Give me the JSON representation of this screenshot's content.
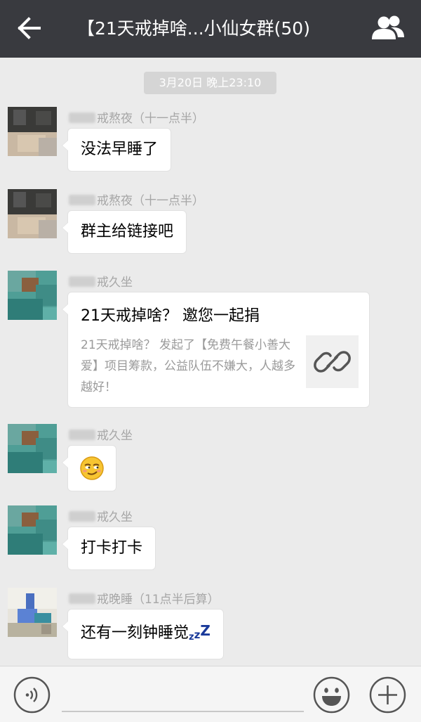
{
  "header": {
    "title": "【21天戒掉啥...小仙女群(50)",
    "back_icon": "arrow-left-icon",
    "group_icon": "group-members-icon"
  },
  "chat": {
    "timestamp": "3月20日 晚上23:10",
    "messages": [
      {
        "sender": "戒熬夜（十一点半）",
        "text": "没法早睡了"
      },
      {
        "sender": "戒熬夜（十一点半）",
        "text": "群主给链接吧"
      },
      {
        "sender": "戒久坐",
        "link": {
          "title": "21天戒掉啥？ 邀您一起捐",
          "description": "21天戒掉啥？ 发起了【免费午餐小善大爱】项目筹款，公益队伍不嫌大，人越多越好！",
          "thumb_icon": "link-icon"
        }
      },
      {
        "sender": "戒久坐",
        "emoji": "smirk-emoji"
      },
      {
        "sender": "戒久坐",
        "text": "打卡打卡"
      },
      {
        "sender": "戒晚睡（11点半后算）",
        "text": "还有一刻钟睡觉"
      }
    ]
  },
  "input_bar": {
    "voice_icon": "voice-icon",
    "emoji_icon": "emoji-icon",
    "plus_icon": "plus-icon"
  },
  "colors": {
    "header_bg": "#393a3f",
    "chat_bg": "#ebebeb",
    "bubble_bg": "#ffffff",
    "timestamp_bg": "#d5d5d5",
    "sender_text": "#a6a6a6"
  }
}
